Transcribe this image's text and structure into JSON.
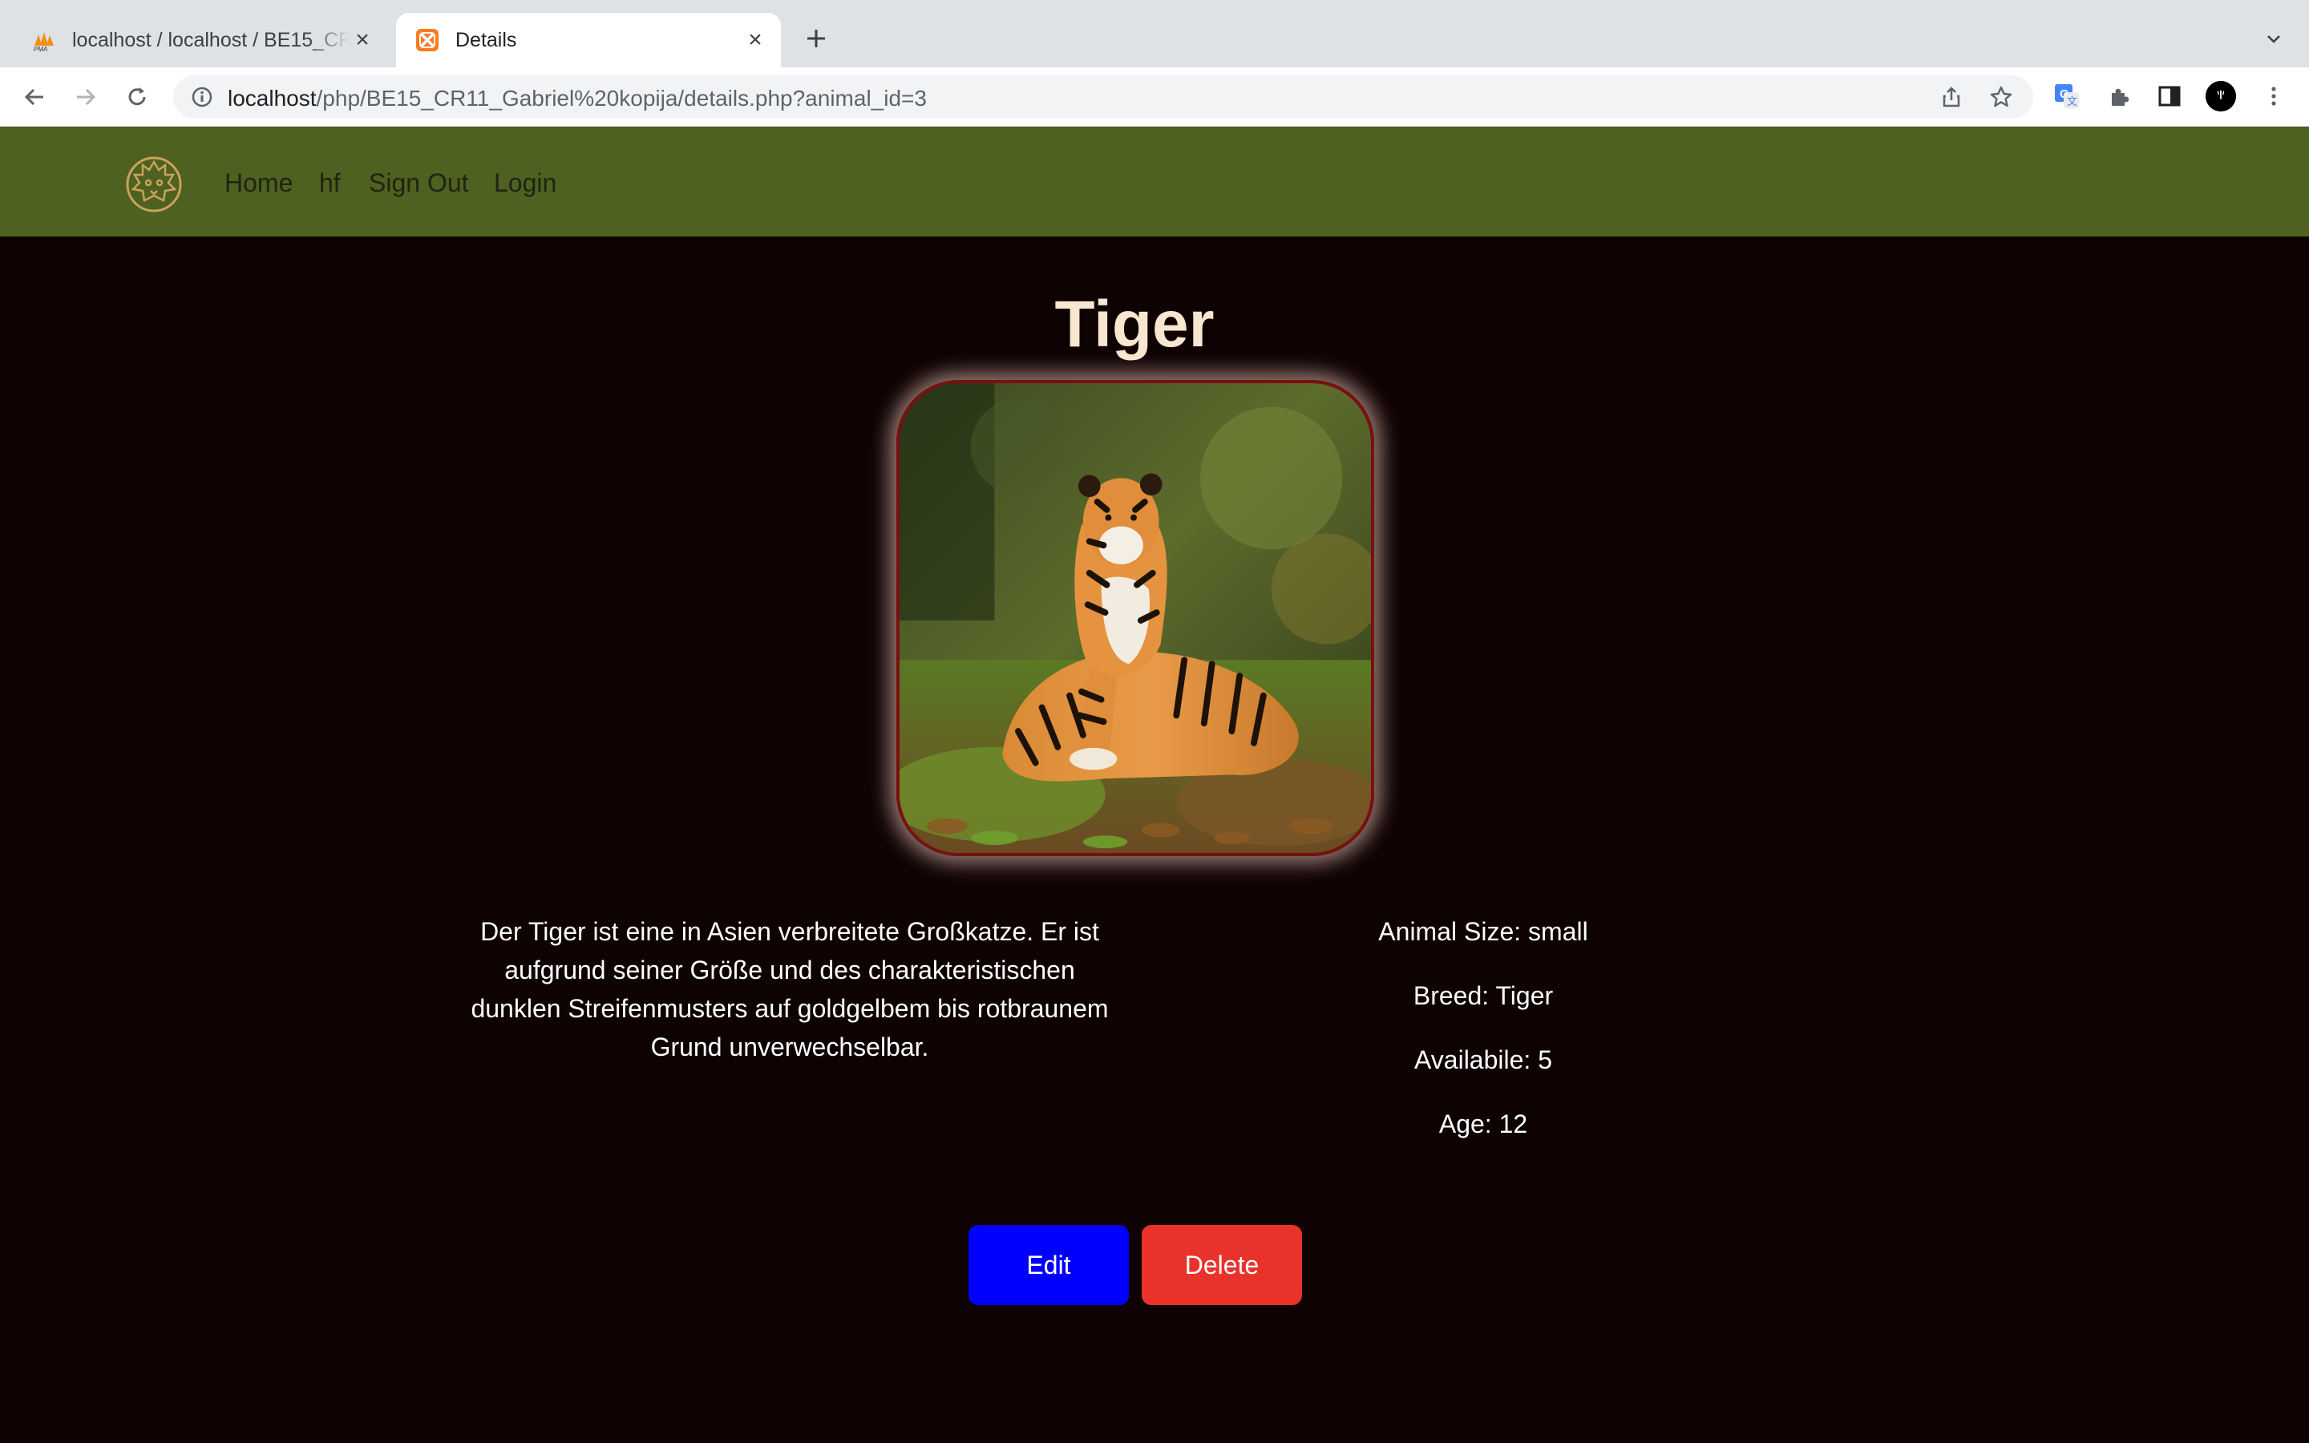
{
  "browser": {
    "tabs": [
      {
        "title": "localhost / localhost / BE15_CR11_Gabriel",
        "favicon": "phpmyadmin-icon",
        "active": false
      },
      {
        "title": "Details",
        "favicon": "xampp-icon",
        "active": true
      }
    ],
    "url_host": "localhost",
    "url_path": "/php/BE15_CR11_Gabriel%20kopija/details.php?animal_id=3"
  },
  "colors": {
    "navbar_bg": "#4e6120",
    "page_bg": "#0e0203",
    "title": "#f8e6d0",
    "edit_button": "#0000ff",
    "delete_button": "#e8322a"
  },
  "navbar": {
    "logo": "lion-logo-icon",
    "links": [
      "Home",
      "hf",
      "Sign Out",
      "Login"
    ]
  },
  "animal": {
    "name": "Tiger",
    "image_alt": "tiger-photo",
    "description": "Der Tiger ist eine in Asien verbreitete Großkatze. Er ist aufgrund seiner Größe und des charakteristischen dunklen Streifenmusters auf goldgelbem bis rotbraunem Grund unverwechselbar.",
    "size": "Animal Size: small",
    "breed": "Breed: Tiger",
    "available": "Availabile: 5",
    "age": "Age: 12"
  },
  "actions": {
    "edit_label": "Edit",
    "delete_label": "Delete"
  }
}
